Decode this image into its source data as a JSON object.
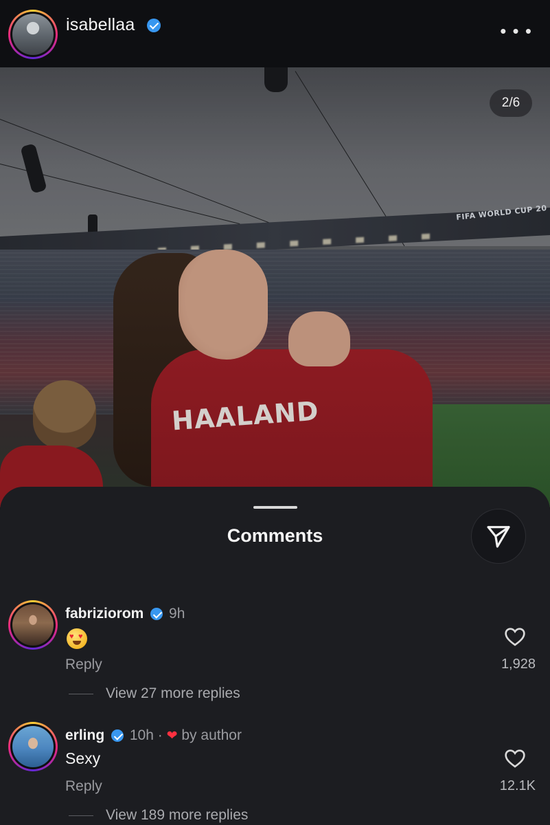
{
  "post": {
    "username": "isabellaa",
    "verified": true,
    "more_icon": "more-horizontal-icon",
    "carousel_counter": "2/6",
    "jersey_text": "HAALAND",
    "stadium_banner": "FIFA WORLD CUP 20"
  },
  "comments_sheet": {
    "title": "Comments",
    "share_icon": "paper-plane-icon",
    "comments": [
      {
        "username": "fabriziorom",
        "verified": true,
        "time": "9h",
        "text_emoji": "heart-eyes-emoji",
        "reply_label": "Reply",
        "likes": "1,928",
        "view_replies": "View 27 more replies"
      },
      {
        "username": "erling",
        "verified": true,
        "time": "10h",
        "separator": "·",
        "liked_by_author": "by author",
        "text": "Sexy",
        "reply_label": "Reply",
        "likes": "12.1K",
        "view_replies": "View 189 more replies"
      }
    ]
  },
  "colors": {
    "background": "#0b0c0e",
    "sheet": "#1c1d21",
    "verified_blue": "#3897f0",
    "author_heart": "#ff3040",
    "secondary_text": "#9a9ba0"
  }
}
